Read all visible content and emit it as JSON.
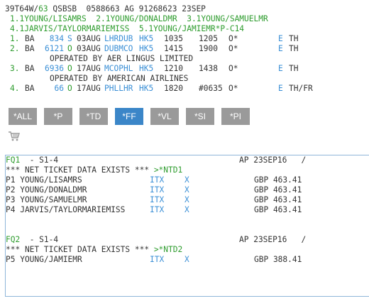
{
  "header": {
    "pnr_prefix": "39T64W/",
    "pnr_agent": "63",
    "pnr_rest": " QSBSB  0588663 AG 91268623 23SEP"
  },
  "names": {
    "line1": "1.1YOUNG/LISAMRS  2.1YOUNG/DONALDMR  3.1YOUNG/SAMUELMR",
    "line2": "4.1JARVIS/TAYLORMARIEMISS  5.1YOUNG/JAMIEMR*P-C14"
  },
  "segments": [
    {
      "num": "1.",
      "airline": "BA",
      "flight": " 834",
      "cls": "S",
      "date": "03AUG",
      "route": "LHRDUB",
      "status": "HK5",
      "dep": "1035",
      "arr": "1205",
      "flag": "O*",
      "eticket": "E",
      "day": "TH"
    },
    {
      "num": "2.",
      "airline": "BA",
      "flight": "6121",
      "cls": "O",
      "date": "03AUG",
      "route": "DUBMCO",
      "status": "HK5",
      "dep": "1415",
      "arr": "1900",
      "flag": "O*",
      "eticket": "E",
      "day": "TH"
    },
    {
      "num": "3.",
      "airline": "BA",
      "flight": "6936",
      "cls": "O",
      "date": "17AUG",
      "route": "MCOPHL",
      "status": "HK5",
      "dep": "1210",
      "arr": "1438",
      "flag": "O*",
      "eticket": "E",
      "day": "TH"
    },
    {
      "num": "4.",
      "airline": "BA",
      "flight": "  66",
      "cls": "O",
      "date": "17AUG",
      "route": "PHLLHR",
      "status": "HK5",
      "dep": "1820",
      "arr": "#0635",
      "flag": "O*",
      "eticket": "E",
      "day": "TH/FR"
    }
  ],
  "operated_notes": {
    "seg2": "OPERATED BY AER LINGUS LIMITED",
    "seg3": "OPERATED BY AMERICAN AIRLINES"
  },
  "toolbar": {
    "buttons": [
      "*ALL",
      "*P",
      "*TD",
      "*FF",
      "*VL",
      "*SI",
      "*PI"
    ],
    "active": "*FF"
  },
  "fares": [
    {
      "id": "FQ1",
      "segments": "  - S1-4",
      "ap_date": "AP 23SEP16   /",
      "net_text": "*** NET TICKET DATA EXISTS *** ",
      "net_link": ">*NTD1",
      "passengers": [
        {
          "p": "P1 YOUNG/LISAMRS",
          "type": "ITX",
          "x": "X",
          "amount": "GBP 463.41"
        },
        {
          "p": "P2 YOUNG/DONALDMR",
          "type": "ITX",
          "x": "X",
          "amount": "GBP 463.41"
        },
        {
          "p": "P3 YOUNG/SAMUELMR",
          "type": "ITX",
          "x": "X",
          "amount": "GBP 463.41"
        },
        {
          "p": "P4 JARVIS/TAYLORMARIEMISS",
          "type": "ITX",
          "x": "X",
          "amount": "GBP 463.41"
        }
      ]
    },
    {
      "id": "FQ2",
      "segments": "  - S1-4",
      "ap_date": "AP 23SEP16   /",
      "net_text": "*** NET TICKET DATA EXISTS *** ",
      "net_link": ">*NTD2",
      "passengers": [
        {
          "p": "P5 YOUNG/JAMIEMR",
          "type": "ITX",
          "x": "X",
          "amount": "GBP 388.41"
        }
      ]
    }
  ],
  "colors": {
    "green": "#2e9c2e",
    "blue": "#3a8fd6",
    "button_gray": "#9a9a9a",
    "button_active": "#3b86c8"
  },
  "icons": {
    "cart": "shopping-cart-icon"
  }
}
